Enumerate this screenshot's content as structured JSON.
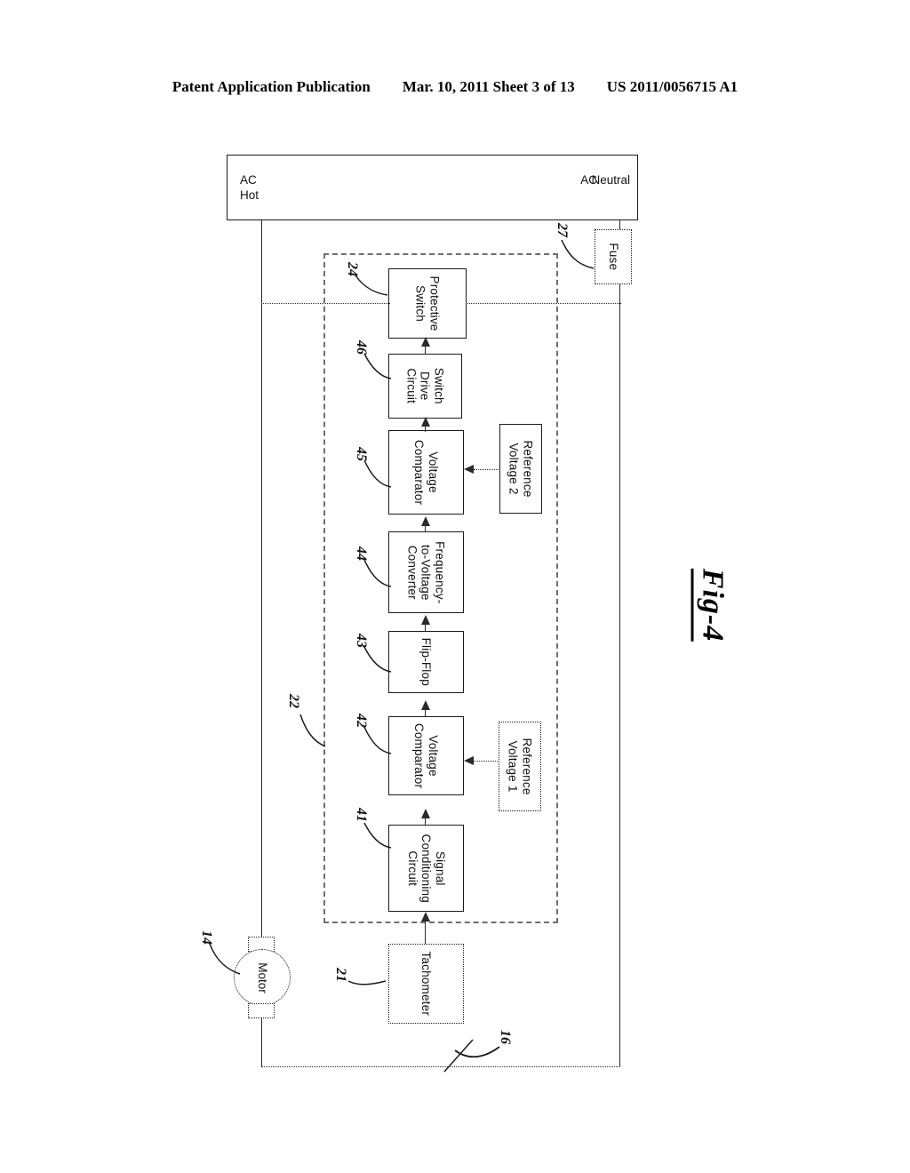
{
  "header": {
    "publication": "Patent Application Publication",
    "date_sheet": "Mar. 10, 2011  Sheet 3 of 13",
    "patent_number": "US 2011/0056715 A1"
  },
  "figure": {
    "caption": "Fig-4"
  },
  "supply": {
    "hot_line1": "AC",
    "hot_line2": "Hot",
    "neutral_line1": "AC",
    "neutral_line2": "Neutral"
  },
  "blocks": {
    "fuse": {
      "label": "Fuse",
      "ref": "27"
    },
    "protective_switch": {
      "label": "Protective\nSwitch",
      "ref": "24"
    },
    "switch_drive_circuit": {
      "label": "Switch\nDrive\nCircuit",
      "ref": "46"
    },
    "voltage_comparator_2": {
      "label": "Voltage\nComparator",
      "ref": "45"
    },
    "reference_voltage_2": {
      "label": "Reference\nVoltage 2",
      "ref": ""
    },
    "frequency_to_voltage_converter": {
      "label": "Frequency-\nto-Voltage\nConverter",
      "ref": "44"
    },
    "flip_flop": {
      "label": "Flip-Flop",
      "ref": "43"
    },
    "voltage_comparator_1": {
      "label": "Voltage\nComparator",
      "ref": "42"
    },
    "reference_voltage_1": {
      "label": "Reference\nVoltage 1",
      "ref": ""
    },
    "signal_conditioning_circuit": {
      "label": "Signal\nConditioning\nCircuit",
      "ref": "41"
    },
    "tachometer": {
      "label": "Tachometer",
      "ref": "21"
    },
    "motor": {
      "label": "Motor",
      "ref": "14"
    }
  },
  "enclosures": {
    "controller": {
      "ref": "22"
    },
    "system": {
      "ref": "16"
    }
  }
}
